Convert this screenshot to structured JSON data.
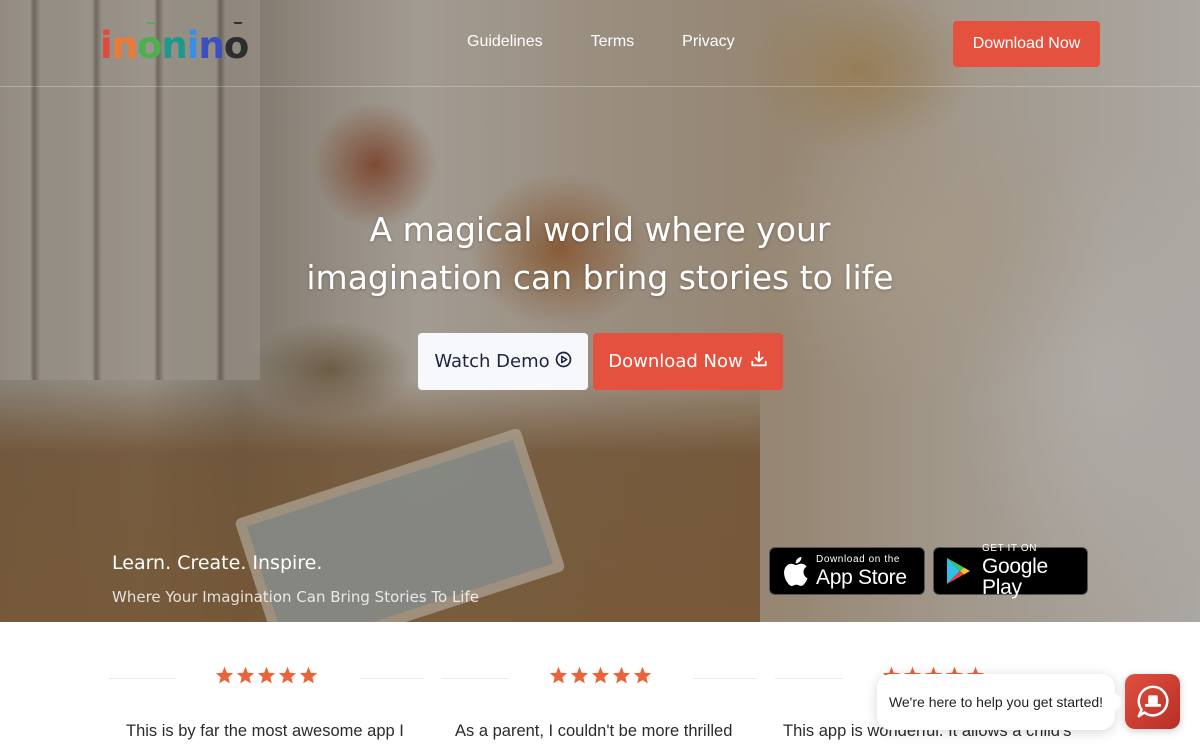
{
  "brand": {
    "logo_letters": [
      {
        "char": "i",
        "color": "#e24b3b"
      },
      {
        "char": "n",
        "color": "#ef7a35"
      },
      {
        "char": "o",
        "color": "#4caf50",
        "antenna": true
      },
      {
        "char": "n",
        "color": "#1e9a8c"
      },
      {
        "char": "i",
        "color": "#3b8ee8"
      },
      {
        "char": "n",
        "color": "#3c4fc0"
      },
      {
        "char": "o",
        "color": "#2e2e2e",
        "antenna": true
      }
    ],
    "name": "inonino"
  },
  "nav": {
    "links": [
      "Guidelines",
      "Terms",
      "Privacy"
    ],
    "cta_label": "Download Now"
  },
  "hero": {
    "title_line1": "A magical world where your",
    "title_line2": "imagination can bring stories to life",
    "watch_demo_label": "Watch Demo",
    "watch_demo_icon": "play-circle-icon",
    "download_label": "Download Now",
    "download_icon": "download-icon",
    "tagline": "Learn. Create. Inspire.",
    "subline": "Where Your Imagination Can Bring Stories To Life",
    "app_store": {
      "small": "Download on the",
      "big": "App Store",
      "icon": "apple-icon"
    },
    "google_play": {
      "small": "GET IT ON",
      "big": "Google Play",
      "icon": "google-play-icon"
    }
  },
  "reviews": [
    {
      "rating": 5,
      "text": "This is by far the most awesome app I"
    },
    {
      "rating": 5,
      "text": "As a parent, I couldn't be more thrilled"
    },
    {
      "rating": 5,
      "text": "This app is wonderful. It allows a child's"
    }
  ],
  "chat": {
    "message": "We're here to help you get started!",
    "icon": "chat-hat-icon"
  },
  "colors": {
    "accent": "#e4523f",
    "star": "#e9633b",
    "demo_text": "#1d2340"
  }
}
